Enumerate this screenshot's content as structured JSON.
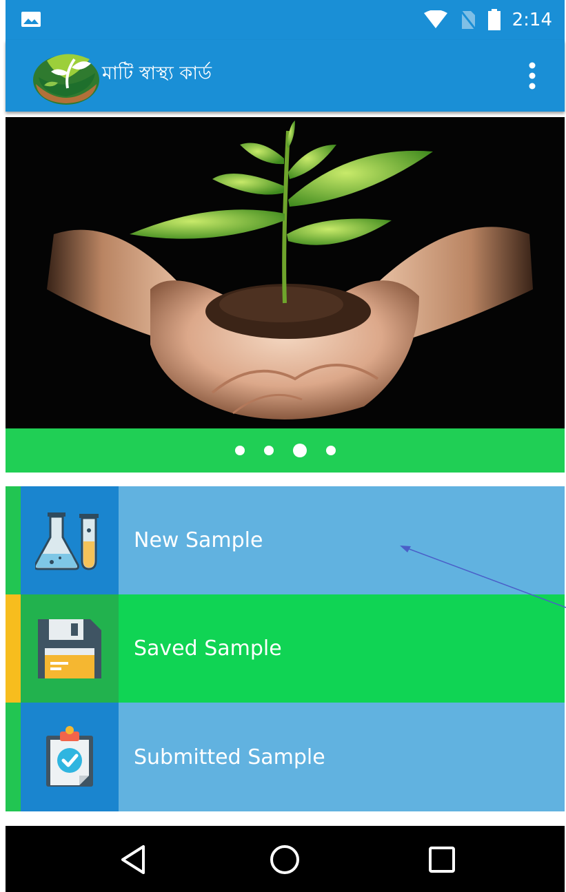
{
  "status_bar": {
    "time": "2:14",
    "icons": [
      "gallery-icon",
      "wifi-icon",
      "no-sim-icon",
      "battery-icon"
    ],
    "background": "#1a8fd6"
  },
  "app_bar": {
    "title": "মাটি স্বাস্থ্য কার্ড",
    "logo_icon": "soil-health-logo",
    "menu_icon": "more-vert-icon",
    "background": "#1a8fd6"
  },
  "banner": {
    "image": "hands-holding-seedling",
    "page_count": 4,
    "active_page": 3,
    "pager_color": "#20cf55"
  },
  "menu": {
    "items": [
      {
        "label": "New Sample",
        "icon": "lab-flask-icon",
        "background": "#61b2e0",
        "accent": "#22c552"
      },
      {
        "label": "Saved Sample",
        "icon": "floppy-disk-icon",
        "background": "#10d454",
        "accent": "#f7bd1e"
      },
      {
        "label": "Submitted Sample",
        "icon": "clipboard-check-icon",
        "background": "#61b2e0",
        "accent": "#22c552"
      }
    ]
  },
  "nav_bar": {
    "buttons": [
      "back-icon",
      "home-icon",
      "recents-icon"
    ]
  }
}
